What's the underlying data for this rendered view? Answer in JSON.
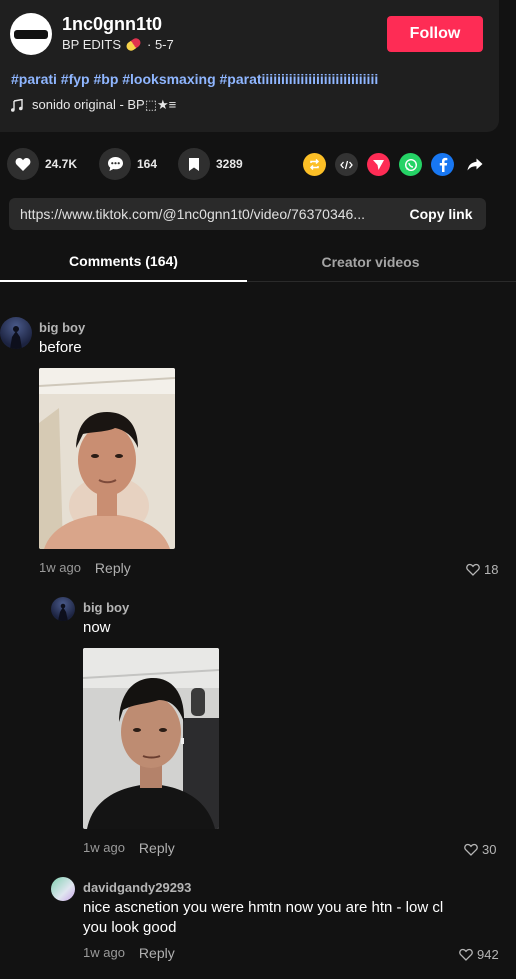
{
  "post": {
    "username": "1nc0gnn1t0",
    "display_name": "BP EDITS",
    "date": "· 5-7",
    "follow_label": "Follow",
    "hashtags": "#parati #fyp #bp #looksmaxing #paratiiiiiiiiiiiiiiiiiiiiiiiiiiiiii",
    "music_label": "sonido original - BP⬚★≡"
  },
  "actions": {
    "likes": "24.7K",
    "comments": "164",
    "saves": "3289"
  },
  "link": {
    "url": "https://www.tiktok.com/@1nc0gnn1t0/video/76370346...",
    "copy_label": "Copy link"
  },
  "tabs": {
    "comments": "Comments (164)",
    "creator_videos": "Creator videos"
  },
  "comments": [
    {
      "author": "big boy",
      "text": "before",
      "time": "1w ago",
      "reply": "Reply",
      "likes": "18"
    },
    {
      "author": "big boy",
      "text": "now",
      "time": "1w ago",
      "reply": "Reply",
      "likes": "30"
    },
    {
      "author": "davidgandy29293",
      "text": "nice ascnetion you were hmtn now you are htn - low cl you look good",
      "time": "1w ago",
      "reply": "Reply",
      "likes": "942"
    }
  ],
  "colors": {
    "follow": "#fe2c55",
    "hashtag": "#8fb6ff",
    "background": "#121212"
  }
}
